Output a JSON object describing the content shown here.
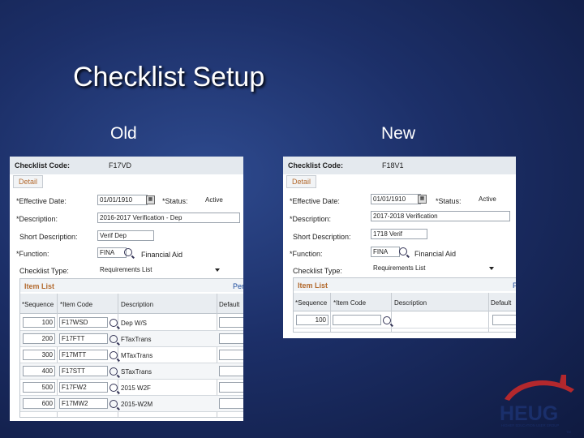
{
  "slide": {
    "title": "Checklist Setup",
    "old_label": "Old",
    "new_label": "New"
  },
  "old": {
    "code_label": "Checklist Code:",
    "code_value": "F17VD",
    "tab_detail": "Detail",
    "effdate_label": "*Effective Date:",
    "effdate_value": "01/01/1910",
    "status_label": "*Status:",
    "status_value": "Active",
    "desc_label": "*Description:",
    "desc_value": "2016-2017 Verification - Dep",
    "short_label": "Short Description:",
    "short_value": "Verif Dep",
    "func_label": "*Function:",
    "func_value": "FINA",
    "func_desc": "Financial Aid",
    "type_label": "Checklist Type:",
    "type_value": "Requirements List",
    "item_list": "Item List",
    "pers": "Pers",
    "headers": [
      "*Sequence",
      "*Item Code",
      "Description",
      "Default"
    ],
    "rows": [
      {
        "seq": "100",
        "code": "F17WSD",
        "desc": "Dep W/S"
      },
      {
        "seq": "200",
        "code": "F17FTT",
        "desc": "FTaxTrans"
      },
      {
        "seq": "300",
        "code": "F17MTT",
        "desc": "MTaxTrans"
      },
      {
        "seq": "400",
        "code": "F17STT",
        "desc": "STaxTrans"
      },
      {
        "seq": "500",
        "code": "F17FW2",
        "desc": "2015 W2F"
      },
      {
        "seq": "600",
        "code": "F17MW2",
        "desc": "2015-W2M"
      }
    ]
  },
  "new": {
    "code_label": "Checklist Code:",
    "code_value": "F18V1",
    "tab_detail": "Detail",
    "effdate_label": "*Effective Date:",
    "effdate_value": "01/01/1910",
    "status_label": "*Status:",
    "status_value": "Active",
    "desc_label": "*Description:",
    "desc_value": "2017-2018 Verification",
    "short_label": "Short Description:",
    "short_value": "1718 Verif",
    "func_label": "*Function:",
    "func_value": "FINA",
    "func_desc": "Financial Aid",
    "type_label": "Checklist Type:",
    "type_value": "Requirements List",
    "item_list": "Item List",
    "pers": "P",
    "headers": [
      "*Sequence",
      "*Item Code",
      "Description",
      "Default"
    ],
    "rows": [
      {
        "seq": "100",
        "code": "",
        "desc": ""
      }
    ]
  },
  "logo": {
    "main": "HEUG",
    "sub": "HIGHER EDUCATION USER GROUP",
    "tm": "TM"
  }
}
